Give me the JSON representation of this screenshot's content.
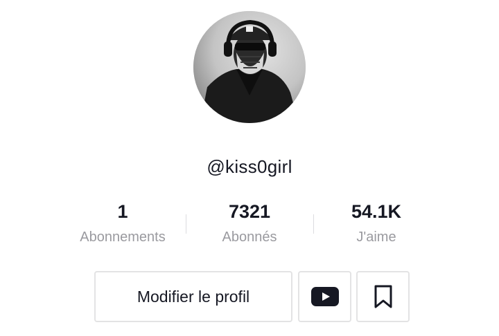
{
  "profile": {
    "username": "@kiss0girl",
    "avatar_icon": "profile-avatar-masked-person"
  },
  "stats": [
    {
      "value": "1",
      "label": "Abonnements"
    },
    {
      "value": "7321",
      "label": "Abonnés"
    },
    {
      "value": "54.1K",
      "label": "J'aime"
    }
  ],
  "actions": {
    "edit_label": "Modifier le profil",
    "youtube_icon": "youtube-icon",
    "bookmark_icon": "bookmark-icon"
  }
}
